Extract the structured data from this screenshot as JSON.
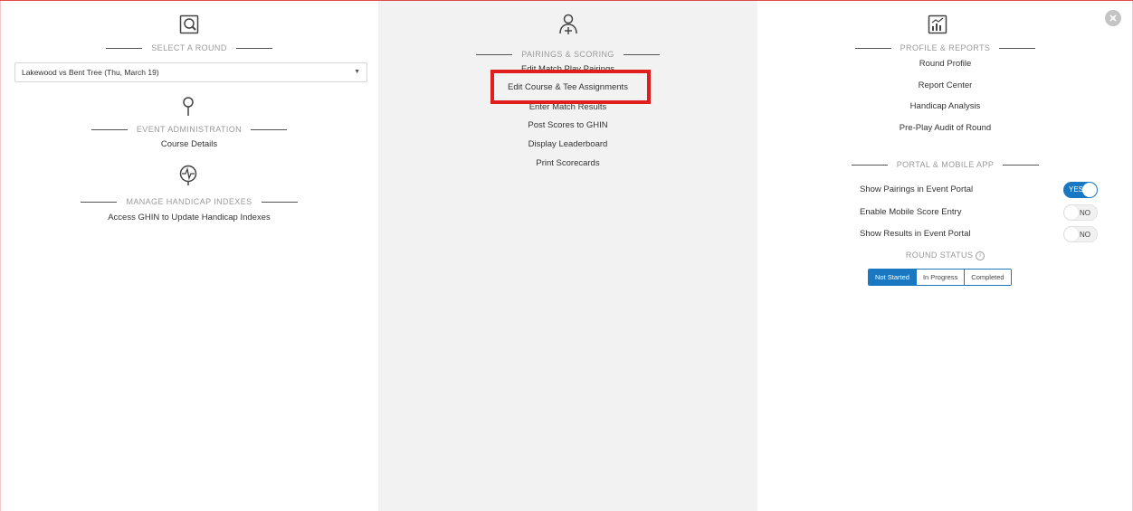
{
  "left": {
    "select_round": {
      "heading": "SELECT A ROUND",
      "value": "Lakewood vs Bent Tree (Thu, March 19)",
      "icon": "magnifier-doc-icon"
    },
    "event_admin": {
      "heading": "EVENT ADMINISTRATION",
      "icon": "pin-icon",
      "links": [
        "Course Details"
      ]
    },
    "handicap": {
      "heading": "MANAGE HANDICAP INDEXES",
      "icon": "pulse-icon",
      "links": [
        "Access GHIN to Update Handicap Indexes"
      ]
    }
  },
  "middle": {
    "heading": "PAIRINGS & SCORING",
    "icon": "people-plus-icon",
    "links": [
      "Edit Match Play Pairings",
      "Edit Course & Tee Assignments",
      "Enter Match Results",
      "Post Scores to GHIN",
      "Display Leaderboard",
      "Print Scorecards"
    ]
  },
  "right": {
    "profile": {
      "heading": "PROFILE & REPORTS",
      "icon": "chart-icon",
      "links": [
        "Round Profile",
        "Report Center",
        "Handicap Analysis",
        "Pre-Play Audit of Round"
      ]
    },
    "portal": {
      "heading": "PORTAL & MOBILE APP",
      "toggles": [
        {
          "label": "Show Pairings in Event Portal",
          "state": "YES"
        },
        {
          "label": "Enable Mobile Score Entry",
          "state": "NO"
        },
        {
          "label": "Show Results in Event Portal",
          "state": "NO"
        }
      ]
    },
    "round_status": {
      "label": "ROUND STATUS",
      "options": [
        "Not Started",
        "In Progress",
        "Completed"
      ],
      "selected": "Not Started"
    }
  },
  "colors": {
    "accent": "#1a78c2",
    "highlight": "#e01e1e",
    "panel": "#f2f2f2"
  }
}
